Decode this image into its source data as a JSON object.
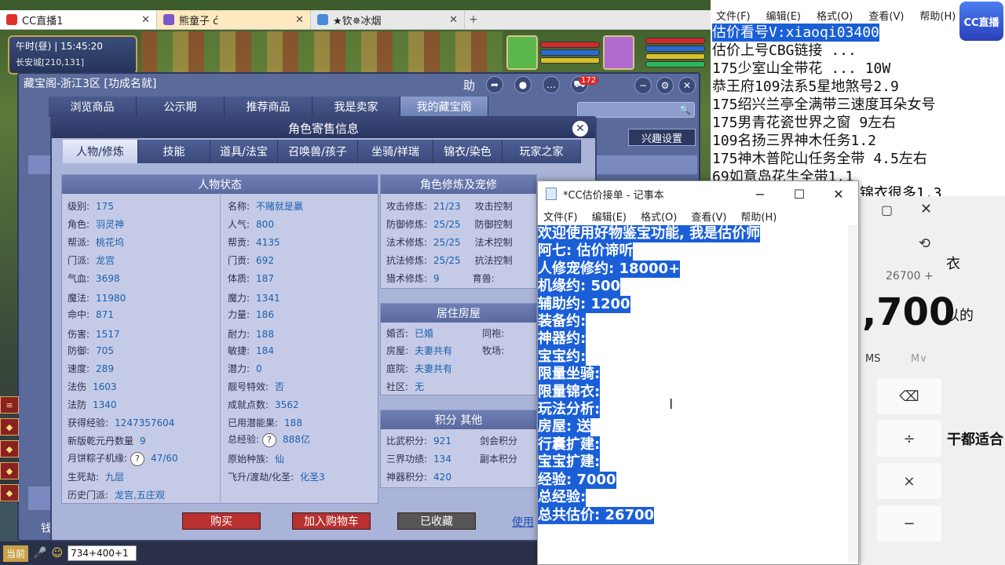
{
  "browser_tabs": [
    {
      "label": "CC直播1"
    },
    {
      "label": "熊童子 ć"
    },
    {
      "label": "★钦✵冰烟"
    }
  ],
  "hud": {
    "time_label": "午时(昼)",
    "time": "15:45:20",
    "location": "长安城[210,131]"
  },
  "cbg": {
    "title": "藏宝阁-浙江3区 [功成名就]",
    "help_label": "助",
    "cart_count": "172",
    "nav": [
      "浏览商品",
      "公示期",
      "推荐商品",
      "我是卖家",
      "我的藏宝阁"
    ],
    "interest_label": "兴趣设置",
    "side_label": "钱"
  },
  "dialog": {
    "title": "角色寄售信息",
    "tabs": [
      "人物/修炼",
      "技能",
      "道具/法宝",
      "召唤兽/孩子",
      "坐骑/祥瑞",
      "锦衣/染色",
      "玩家之家"
    ],
    "status_header": "人物状态",
    "cultivation_header": "角色修炼及宠修",
    "house_header": "居住房屋",
    "score_header": "积分 其他",
    "left_col": [
      {
        "k": "级别:",
        "v": "175"
      },
      {
        "k": "角色:",
        "v": "羽灵神"
      },
      {
        "k": "帮派:",
        "v": "桃花坞"
      },
      {
        "k": "门派:",
        "v": "龙宫"
      },
      {
        "k": "气血:",
        "v": "3698"
      },
      {
        "k": "魔法:",
        "v": "11980"
      },
      {
        "k": "命中:",
        "v": "871"
      },
      {
        "k": "伤害:",
        "v": "1517"
      },
      {
        "k": "防御:",
        "v": "705"
      },
      {
        "k": "速度:",
        "v": "289"
      },
      {
        "k": "法伤",
        "v": "1603"
      },
      {
        "k": "法防",
        "v": "1340"
      },
      {
        "k": "获得经验:",
        "v": "1247357604"
      },
      {
        "k": "新版乾元丹数量",
        "v": "9"
      },
      {
        "k": "月饼粽子机缘:",
        "v": "47/60"
      },
      {
        "k": "生死劫:",
        "v": "九层"
      },
      {
        "k": "历史门派:",
        "v": "龙宫,五庄观"
      }
    ],
    "mid_col": [
      {
        "k": "名称:",
        "v": "不赌就是赢"
      },
      {
        "k": "人气:",
        "v": "800"
      },
      {
        "k": "帮贡:",
        "v": "4135"
      },
      {
        "k": "门贡:",
        "v": "692"
      },
      {
        "k": "体质:",
        "v": "187"
      },
      {
        "k": "魔力:",
        "v": "1341"
      },
      {
        "k": "力量:",
        "v": "186"
      },
      {
        "k": "耐力:",
        "v": "188"
      },
      {
        "k": "敏捷:",
        "v": "184"
      },
      {
        "k": "潜力:",
        "v": "0"
      },
      {
        "k": "靓号特效:",
        "v": "否"
      },
      {
        "k": "成就点数:",
        "v": "3562"
      },
      {
        "k": "已用潜能果:",
        "v": "188"
      },
      {
        "k": "总经验:",
        "v": "888亿"
      },
      {
        "k": "原始种族:",
        "v": "仙"
      },
      {
        "k": "飞升/渡劫/化圣:",
        "v": "化圣3"
      }
    ],
    "cultivation": [
      {
        "k": "攻击修炼:",
        "v": "21/23",
        "k2": "攻击控制"
      },
      {
        "k": "防御修炼:",
        "v": "25/25",
        "k2": "防御控制"
      },
      {
        "k": "法术修炼:",
        "v": "25/25",
        "k2": "法术控制"
      },
      {
        "k": "抗法修炼:",
        "v": "25/25",
        "k2": "抗法控制"
      },
      {
        "k": "猎术修炼:",
        "v": "9",
        "k2": "育兽:"
      }
    ],
    "house": [
      {
        "k": "婚否:",
        "v": "已婚",
        "k2": "同袍:"
      },
      {
        "k": "房屋:",
        "v": "夫妻共有",
        "k2": "牧场:"
      },
      {
        "k": "庭院:",
        "v": "夫妻共有",
        "k2": ""
      },
      {
        "k": "社区:",
        "v": "无",
        "k2": ""
      }
    ],
    "score": [
      {
        "k": "比武积分:",
        "v": "921",
        "k2": "剑会积分"
      },
      {
        "k": "三界功绩:",
        "v": "134",
        "k2": "副本积分"
      },
      {
        "k": "神器积分:",
        "v": "420",
        "k2": ""
      }
    ],
    "buttons": {
      "buy": "购买",
      "add_cart": "加入购物车",
      "favorited": "已收藏",
      "use": "使用"
    }
  },
  "chat": {
    "channel": "当前",
    "input_value": "734+400+1"
  },
  "notepad_bg": {
    "menu": [
      "文件(F)",
      "编辑(E)",
      "格式(O)",
      "查看(V)",
      "帮助(H)"
    ],
    "lines": [
      "估价看号V:xiaoqi03400",
      "估价上号CBG链接 ...",
      "175少室山全带花 ... 10W",
      "恭王府109法系5星地煞号2.9",
      "175绍兴兰亭全满带三速度耳朵女号",
      "175男青花瓷世界之窗  9左右",
      "109名扬三界神木任务1.2",
      "175神木普陀山任务全带 4.5左右",
      "69如意岛花生全带1.1"
    ],
    "logo": "CC直播"
  },
  "calculator": {
    "expression": "26700 +",
    "display": ",700",
    "ms": "MS",
    "mv": "M∨",
    "backspace": "⌫",
    "divide": "÷",
    "multiply": "×",
    "minus": "−",
    "behind_text_1": "锦衣很多1.3",
    "behind_text_2": "衣",
    "behind_text_3": "以的",
    "behind_text_4": "干都适合"
  },
  "notepad_front": {
    "title": "*CC估价接单 - 记事本",
    "menu": [
      "文件(F)",
      "编辑(E)",
      "格式(O)",
      "查看(V)",
      "帮助(H)"
    ],
    "lines": [
      "欢迎使用好物鉴宝功能, 我是估价师",
      "阿七: 估价谛听",
      "人修宠修约: 18000+",
      "机缘约: 500",
      "辅助约: 1200",
      "装备约:",
      "神器约:",
      "宝宝约:",
      "限量坐骑:",
      "限量锦衣:",
      "玩法分析:",
      "房屋: 送",
      "行囊扩建:",
      "宝宝扩建:",
      "经验: 7000",
      "总经验:",
      "总共估价: 26700"
    ]
  }
}
